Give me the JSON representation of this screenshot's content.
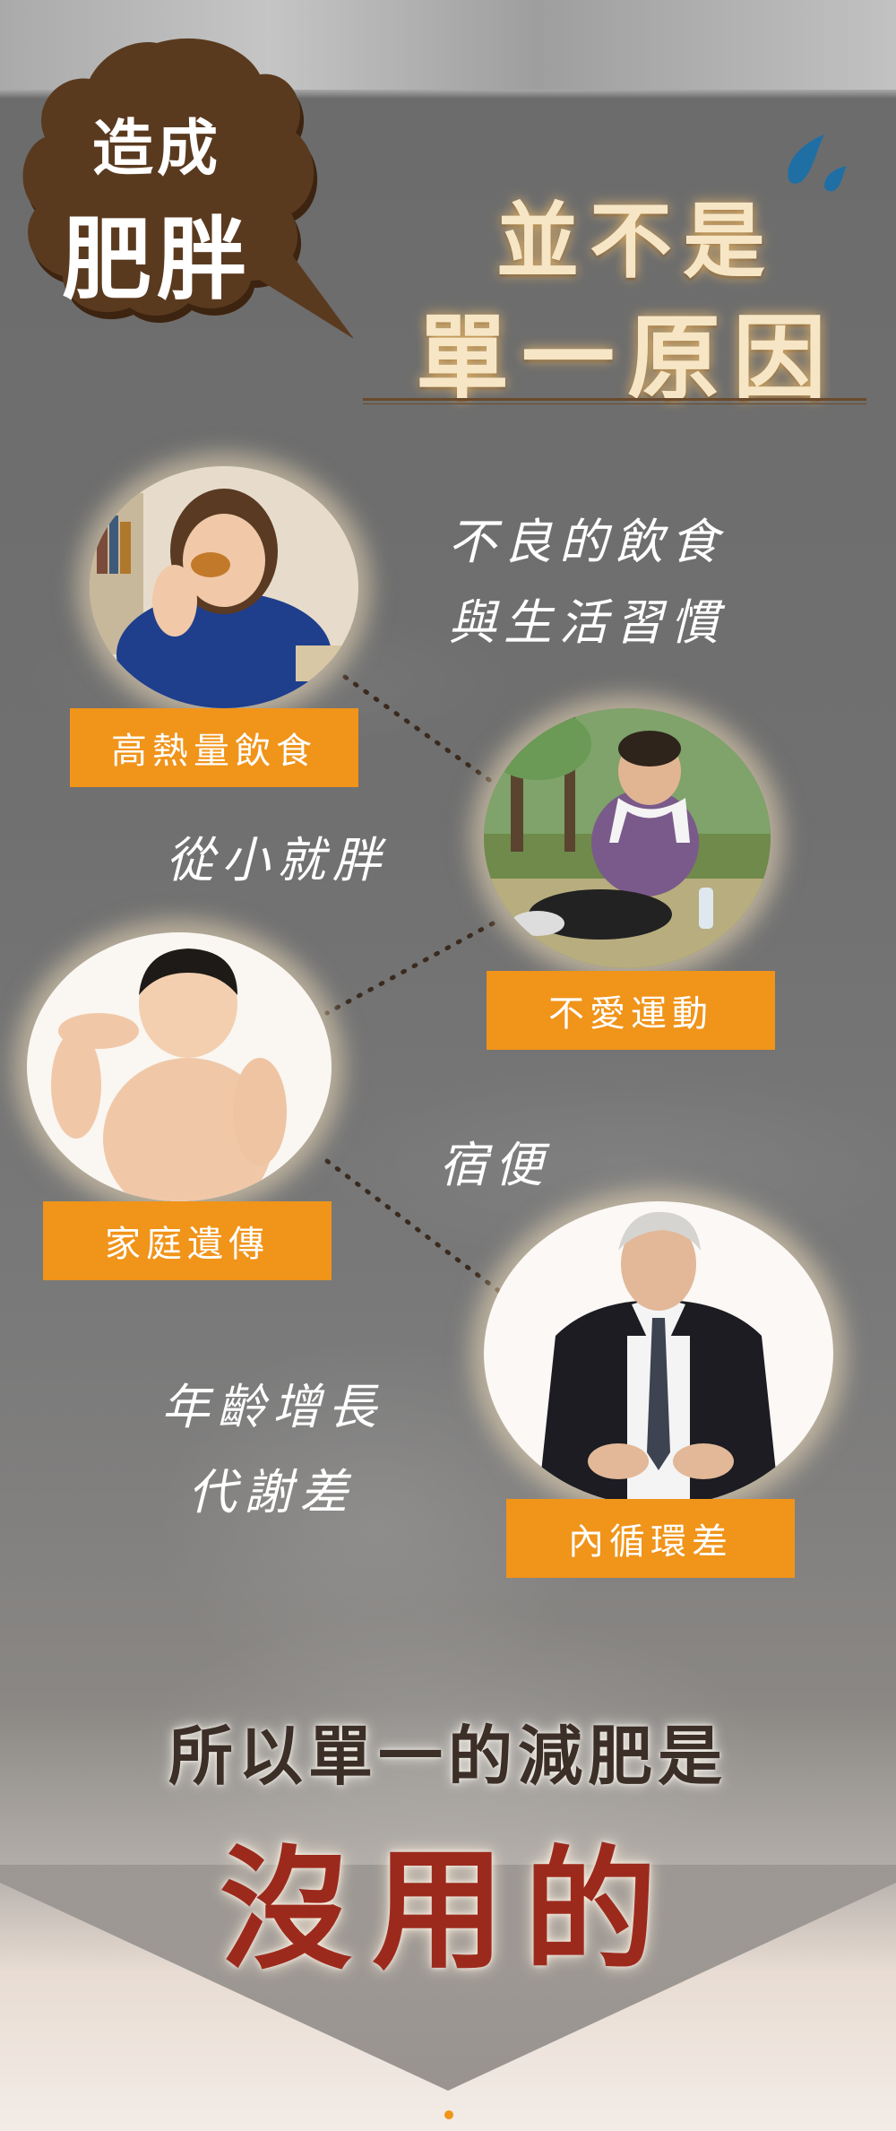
{
  "bubble": {
    "line1": "造成",
    "line2": "肥胖"
  },
  "headline": {
    "line1": "並不是",
    "line2": "單一原因"
  },
  "causes": [
    {
      "tag": "高熱量飲食",
      "photo": "woman-eating-fried-chicken"
    },
    {
      "tag": "不愛運動",
      "photo": "woman-resting-in-park"
    },
    {
      "tag": "家庭遺傳",
      "photo": "boy-flexing-arm"
    },
    {
      "tag": "內循環差",
      "photo": "man-holding-belly"
    }
  ],
  "notes": {
    "habits_line1": "不良的飲食",
    "habits_line2": "與生活習慣",
    "childhood": "從小就胖",
    "constipation": "宿便",
    "age_line1": "年齡增長",
    "age_line2": "代謝差"
  },
  "conclusion": {
    "line1": "所以單一的減肥是",
    "line2": "沒用的"
  },
  "colors": {
    "tag": "#f0941a",
    "bubble": "#5a3a1f",
    "accent_red": "#9c2a1c",
    "headline_glow": "#f0be6e"
  }
}
